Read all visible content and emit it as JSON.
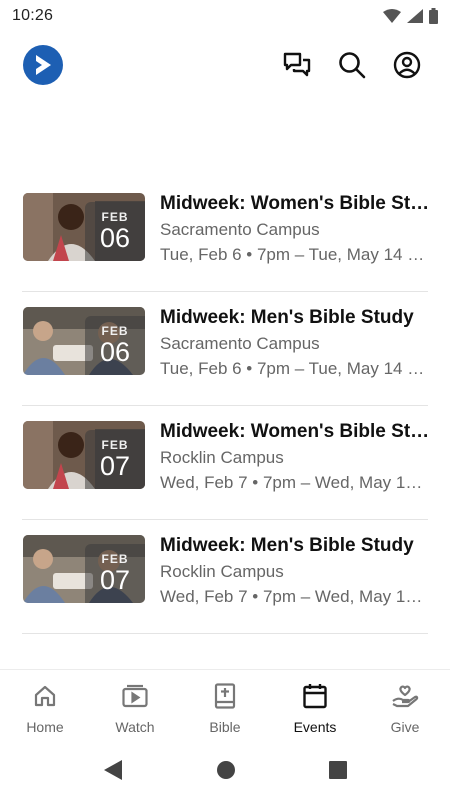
{
  "status_bar": {
    "time": "10:26"
  },
  "app_bar": {
    "logo": "play-logo-icon",
    "actions": [
      "chat-icon",
      "search-icon",
      "account-icon"
    ]
  },
  "events": [
    {
      "title": "Midweek: Women's Bible St…",
      "campus": "Sacramento Campus",
      "time": "Tue, Feb 6 • 7pm – Tue, May 14 • …",
      "month": "FEB",
      "day": "06",
      "image": "women-bible-study-photo"
    },
    {
      "title": "Midweek: Men's Bible Study",
      "campus": "Sacramento Campus",
      "time": "Tue, Feb 6 • 7pm – Tue, May 14 • …",
      "month": "FEB",
      "day": "06",
      "image": "men-bible-study-photo"
    },
    {
      "title": "Midweek: Women's Bible St…",
      "campus": "Rocklin Campus",
      "time": "Wed, Feb 7 • 7pm – Wed, May 15…",
      "month": "FEB",
      "day": "07",
      "image": "women-bible-study-photo"
    },
    {
      "title": "Midweek: Men's Bible Study",
      "campus": "Rocklin Campus",
      "time": "Wed, Feb 7 • 7pm – Wed, May 15…",
      "month": "FEB",
      "day": "07",
      "image": "men-bible-study-photo"
    }
  ],
  "bottom_nav": [
    {
      "label": "Home",
      "icon": "home-icon"
    },
    {
      "label": "Watch",
      "icon": "watch-icon"
    },
    {
      "label": "Bible",
      "icon": "bible-icon"
    },
    {
      "label": "Events",
      "icon": "calendar-icon",
      "active": true
    },
    {
      "label": "Give",
      "icon": "give-icon"
    }
  ],
  "colors": {
    "brand": "#1d5fb3",
    "text_primary": "#111111",
    "text_secondary": "#666666",
    "divider": "#e4e4e4"
  }
}
